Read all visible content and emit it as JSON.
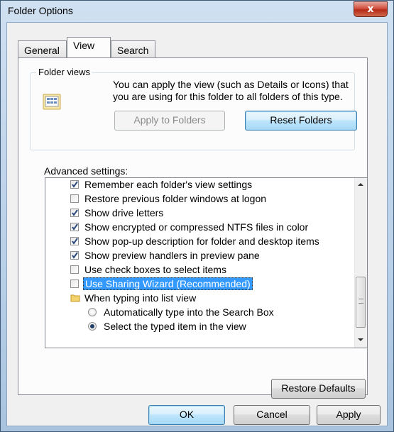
{
  "window": {
    "title": "Folder Options",
    "close_label": "x"
  },
  "tabs": [
    {
      "label": "General"
    },
    {
      "label": "View"
    },
    {
      "label": "Search"
    }
  ],
  "folder_views": {
    "legend": "Folder views",
    "description": "You can apply the view (such as Details or Icons) that you are using for this folder to all folders of this type.",
    "apply_button": "Apply to Folders",
    "reset_button": "Reset Folders"
  },
  "advanced": {
    "label": "Advanced settings:",
    "items": [
      {
        "type": "checkbox",
        "checked": true,
        "label": "Remember each folder's view settings"
      },
      {
        "type": "checkbox",
        "checked": false,
        "label": "Restore previous folder windows at logon"
      },
      {
        "type": "checkbox",
        "checked": true,
        "label": "Show drive letters"
      },
      {
        "type": "checkbox",
        "checked": true,
        "label": "Show encrypted or compressed NTFS files in color"
      },
      {
        "type": "checkbox",
        "checked": true,
        "label": "Show pop-up description for folder and desktop items"
      },
      {
        "type": "checkbox",
        "checked": true,
        "label": "Show preview handlers in preview pane"
      },
      {
        "type": "checkbox",
        "checked": false,
        "label": "Use check boxes to select items"
      },
      {
        "type": "checkbox",
        "checked": false,
        "label": "Use Sharing Wizard (Recommended)",
        "selected": true
      },
      {
        "type": "folder",
        "label": "When typing into list view"
      },
      {
        "type": "radio",
        "checked": false,
        "label": "Automatically type into the Search Box"
      },
      {
        "type": "radio",
        "checked": true,
        "label": "Select the typed item in the view"
      }
    ]
  },
  "restore_defaults": "Restore Defaults",
  "footer": {
    "ok": "OK",
    "cancel": "Cancel",
    "apply": "Apply"
  }
}
